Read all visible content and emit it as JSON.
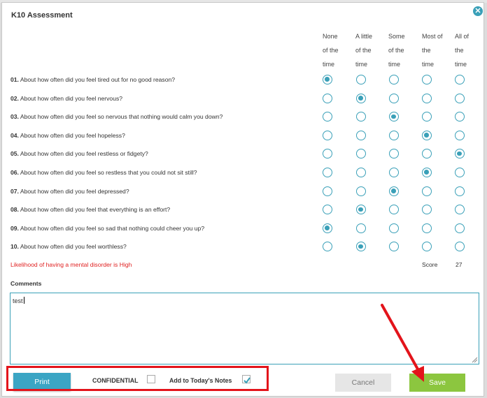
{
  "dialog": {
    "title": "K10 Assessment"
  },
  "columns": [
    [
      "None",
      "of the",
      "time"
    ],
    [
      "A little",
      "of the",
      "time"
    ],
    [
      "Some",
      "of the",
      "time"
    ],
    [
      "Most of",
      "the",
      "time"
    ],
    [
      "All of",
      "the",
      "time"
    ]
  ],
  "questions": [
    {
      "num": "01.",
      "text": " About how often did you feel tired out for no good reason?",
      "selected": 0
    },
    {
      "num": "02.",
      "text": " About how often did you feel nervous?",
      "selected": 1
    },
    {
      "num": "03.",
      "text": " About how often did you feel so nervous that nothing would calm you down?",
      "selected": 2
    },
    {
      "num": "04.",
      "text": " About how often did you feel hopeless?",
      "selected": 3
    },
    {
      "num": "05.",
      "text": " About how often did you feel restless or fidgety?",
      "selected": 4
    },
    {
      "num": "06.",
      "text": " About how often did you feel so restless that you could not sit still?",
      "selected": 3
    },
    {
      "num": "07.",
      "text": " About how often did you feel depressed?",
      "selected": 2
    },
    {
      "num": "08.",
      "text": " About how often did you feel that everything is an effort?",
      "selected": 1
    },
    {
      "num": "09.",
      "text": " About how often did you feel so sad that nothing could cheer you up?",
      "selected": 0
    },
    {
      "num": "10.",
      "text": " About how often did you feel worthless?",
      "selected": 1
    }
  ],
  "result": {
    "likelihood": "Likelihood of having a mental disorder is High",
    "score_label": "Score",
    "score_value": "27"
  },
  "comments": {
    "label": "Comments",
    "value": "test"
  },
  "footer": {
    "print_label": "Print",
    "confidential_label": "CONFIDENTIAL",
    "confidential_checked": false,
    "notes_label": "Add to Today's Notes",
    "notes_checked": true,
    "cancel_label": "Cancel",
    "save_label": "Save"
  },
  "colors": {
    "accent": "#3aa0b8",
    "save": "#8cc63f",
    "alert": "#e02020",
    "annotation": "#e3141b"
  }
}
